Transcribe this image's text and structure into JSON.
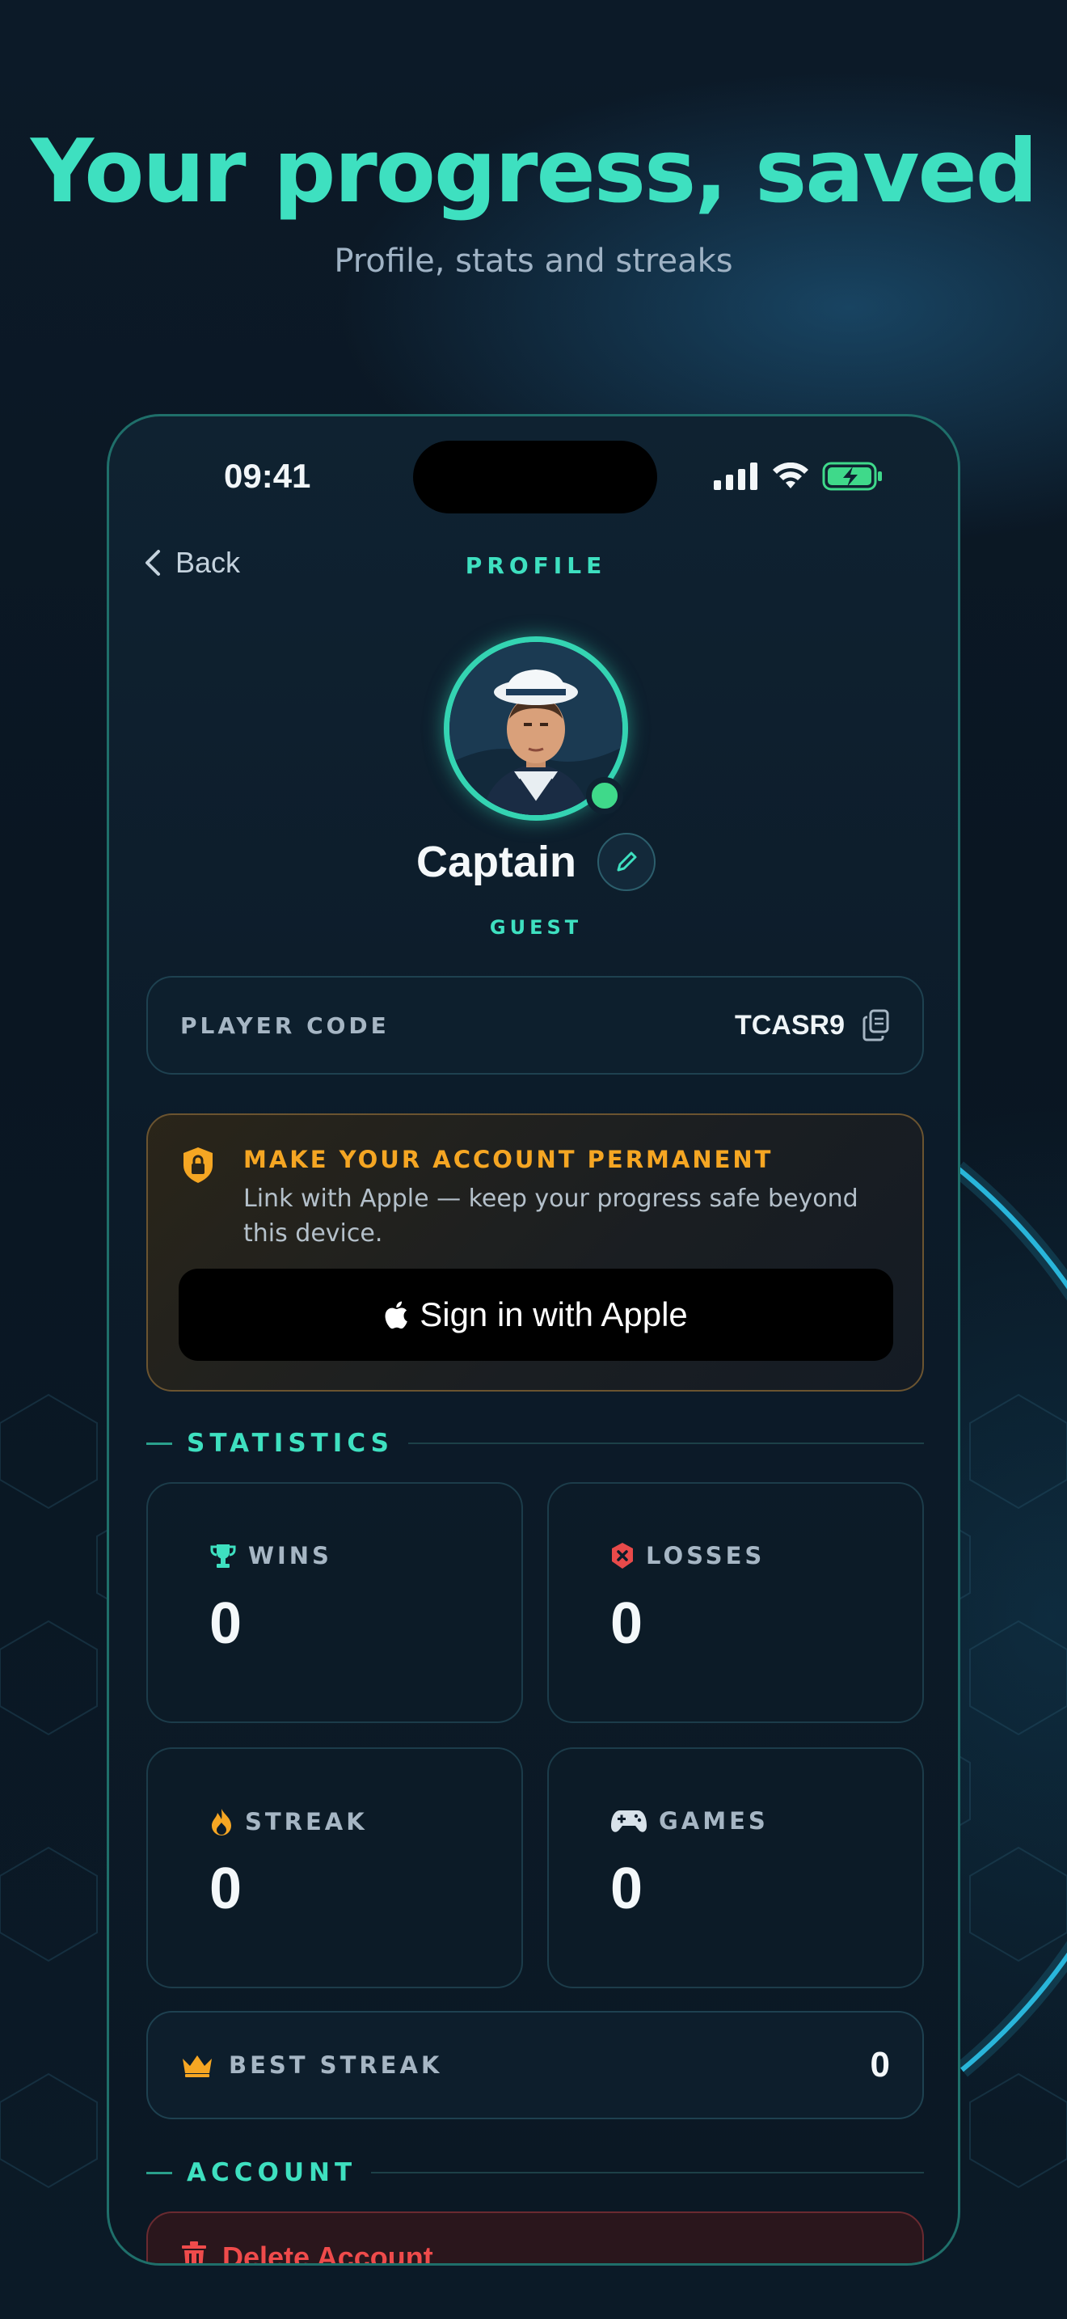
{
  "marketing": {
    "headline": "Your progress, saved",
    "subhead": "Profile, stats and streaks"
  },
  "status_bar": {
    "time": "09:41",
    "icons": [
      "signal-icon",
      "wifi-icon",
      "battery-charging-icon"
    ]
  },
  "nav": {
    "back_label": "Back",
    "title": "PROFILE"
  },
  "profile": {
    "name": "Captain",
    "status": "GUEST",
    "online": true
  },
  "player_code": {
    "label": "PLAYER CODE",
    "value": "TCASR9"
  },
  "permanent_account": {
    "title": "MAKE YOUR ACCOUNT PERMANENT",
    "text": "Link with Apple — keep your progress safe beyond this device.",
    "button_label": "Sign in with Apple"
  },
  "statistics": {
    "section_label": "STATISTICS",
    "items": [
      {
        "label": "WINS",
        "value": "0",
        "icon": "trophy-icon"
      },
      {
        "label": "LOSSES",
        "value": "0",
        "icon": "x-shield-icon"
      },
      {
        "label": "STREAK",
        "value": "0",
        "icon": "flame-icon"
      },
      {
        "label": "GAMES",
        "value": "0",
        "icon": "gamepad-icon"
      }
    ],
    "best_streak": {
      "label": "BEST STREAK",
      "value": "0",
      "icon": "crown-icon"
    }
  },
  "account": {
    "section_label": "ACCOUNT",
    "delete_label": "Delete Account"
  },
  "colors": {
    "accent": "#3ee0c0",
    "warning": "#f5a623",
    "danger": "#ef4b4b",
    "background": "#0a1622"
  }
}
